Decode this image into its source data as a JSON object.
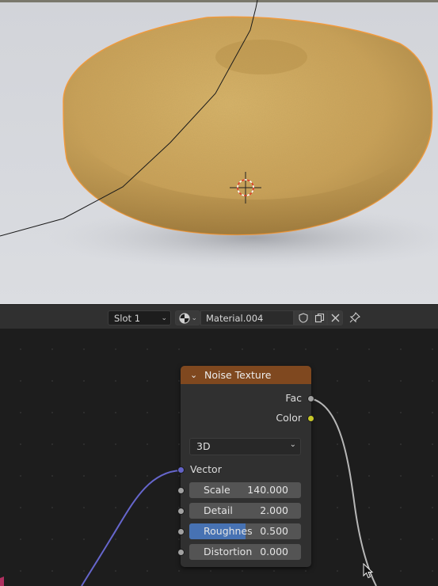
{
  "header": {
    "slot_select": "Slot 1",
    "material_name": "Material.004"
  },
  "node": {
    "title": "Noise Texture",
    "outputs": [
      "Fac",
      "Color"
    ],
    "dimension": "3D",
    "vector_label": "Vector",
    "params": [
      {
        "label": "Scale",
        "value": "140.000"
      },
      {
        "label": "Detail",
        "value": "2.000"
      },
      {
        "label": "Roughnes",
        "value": "0.500",
        "fraction": 0.5
      },
      {
        "label": "Distortion",
        "value": "0.000"
      }
    ]
  },
  "colors": {
    "node_header": "#7f481f",
    "fac_socket": "#a1a1a1",
    "color_socket": "#c7c729",
    "vector_socket": "#6363c7",
    "selection_outline": "#f59a3b",
    "slider_fill": "#4772b3"
  }
}
